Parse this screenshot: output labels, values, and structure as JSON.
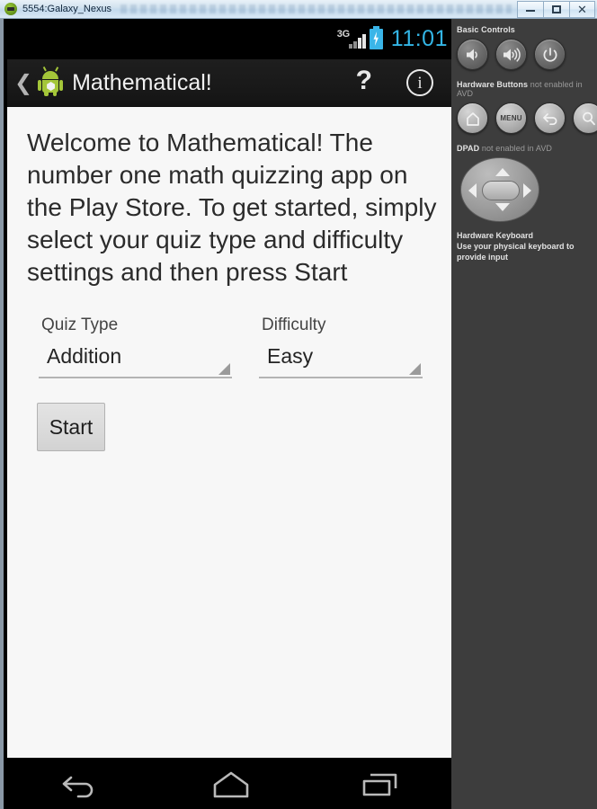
{
  "window": {
    "title": "5554:Galaxy_Nexus",
    "icon": "android-robot-icon",
    "minimize_label": "Minimize",
    "maximize_label": "Maximize",
    "close_label": "✕"
  },
  "statusbar": {
    "network_type": "3G",
    "signal_icon": "signal-bars-icon",
    "battery_icon": "battery-charging-icon",
    "clock": "11:01",
    "clock_color": "#33b5e5"
  },
  "actionbar": {
    "back_chevron": "❮",
    "app_icon": "android-robot-icon",
    "title": "Mathematical!",
    "help_label": "?",
    "info_label": "i"
  },
  "content": {
    "welcome_text": "Welcome to Mathematical! The number one math quizzing app on the Play Store. To get started, simply select your quiz type and difficulty settings and then press Start",
    "quiz_type": {
      "label": "Quiz Type",
      "value": "Addition"
    },
    "difficulty": {
      "label": "Difficulty",
      "value": "Easy"
    },
    "start_button": "Start"
  },
  "navbar": {
    "back": "back-icon",
    "home": "home-icon",
    "recents": "recents-icon"
  },
  "panel": {
    "basic_controls_title": "Basic Controls",
    "basic_buttons": [
      {
        "name": "volume-down-button",
        "icon": "speaker-low-icon"
      },
      {
        "name": "volume-up-button",
        "icon": "speaker-high-icon"
      },
      {
        "name": "power-button",
        "icon": "power-icon"
      }
    ],
    "hardware_buttons_title": "Hardware Buttons",
    "hardware_buttons_note": "not enabled in AVD",
    "hardware_buttons": [
      {
        "name": "home-button",
        "icon": "home-icon",
        "label": ""
      },
      {
        "name": "menu-button",
        "icon": "menu-icon",
        "label": "MENU"
      },
      {
        "name": "back-button",
        "icon": "back-arrow-icon",
        "label": ""
      },
      {
        "name": "search-button",
        "icon": "search-icon",
        "label": ""
      }
    ],
    "dpad_title": "DPAD",
    "dpad_note": "not enabled in AVD",
    "keyboard_title": "Hardware Keyboard",
    "keyboard_note": "Use your physical keyboard to provide input"
  }
}
